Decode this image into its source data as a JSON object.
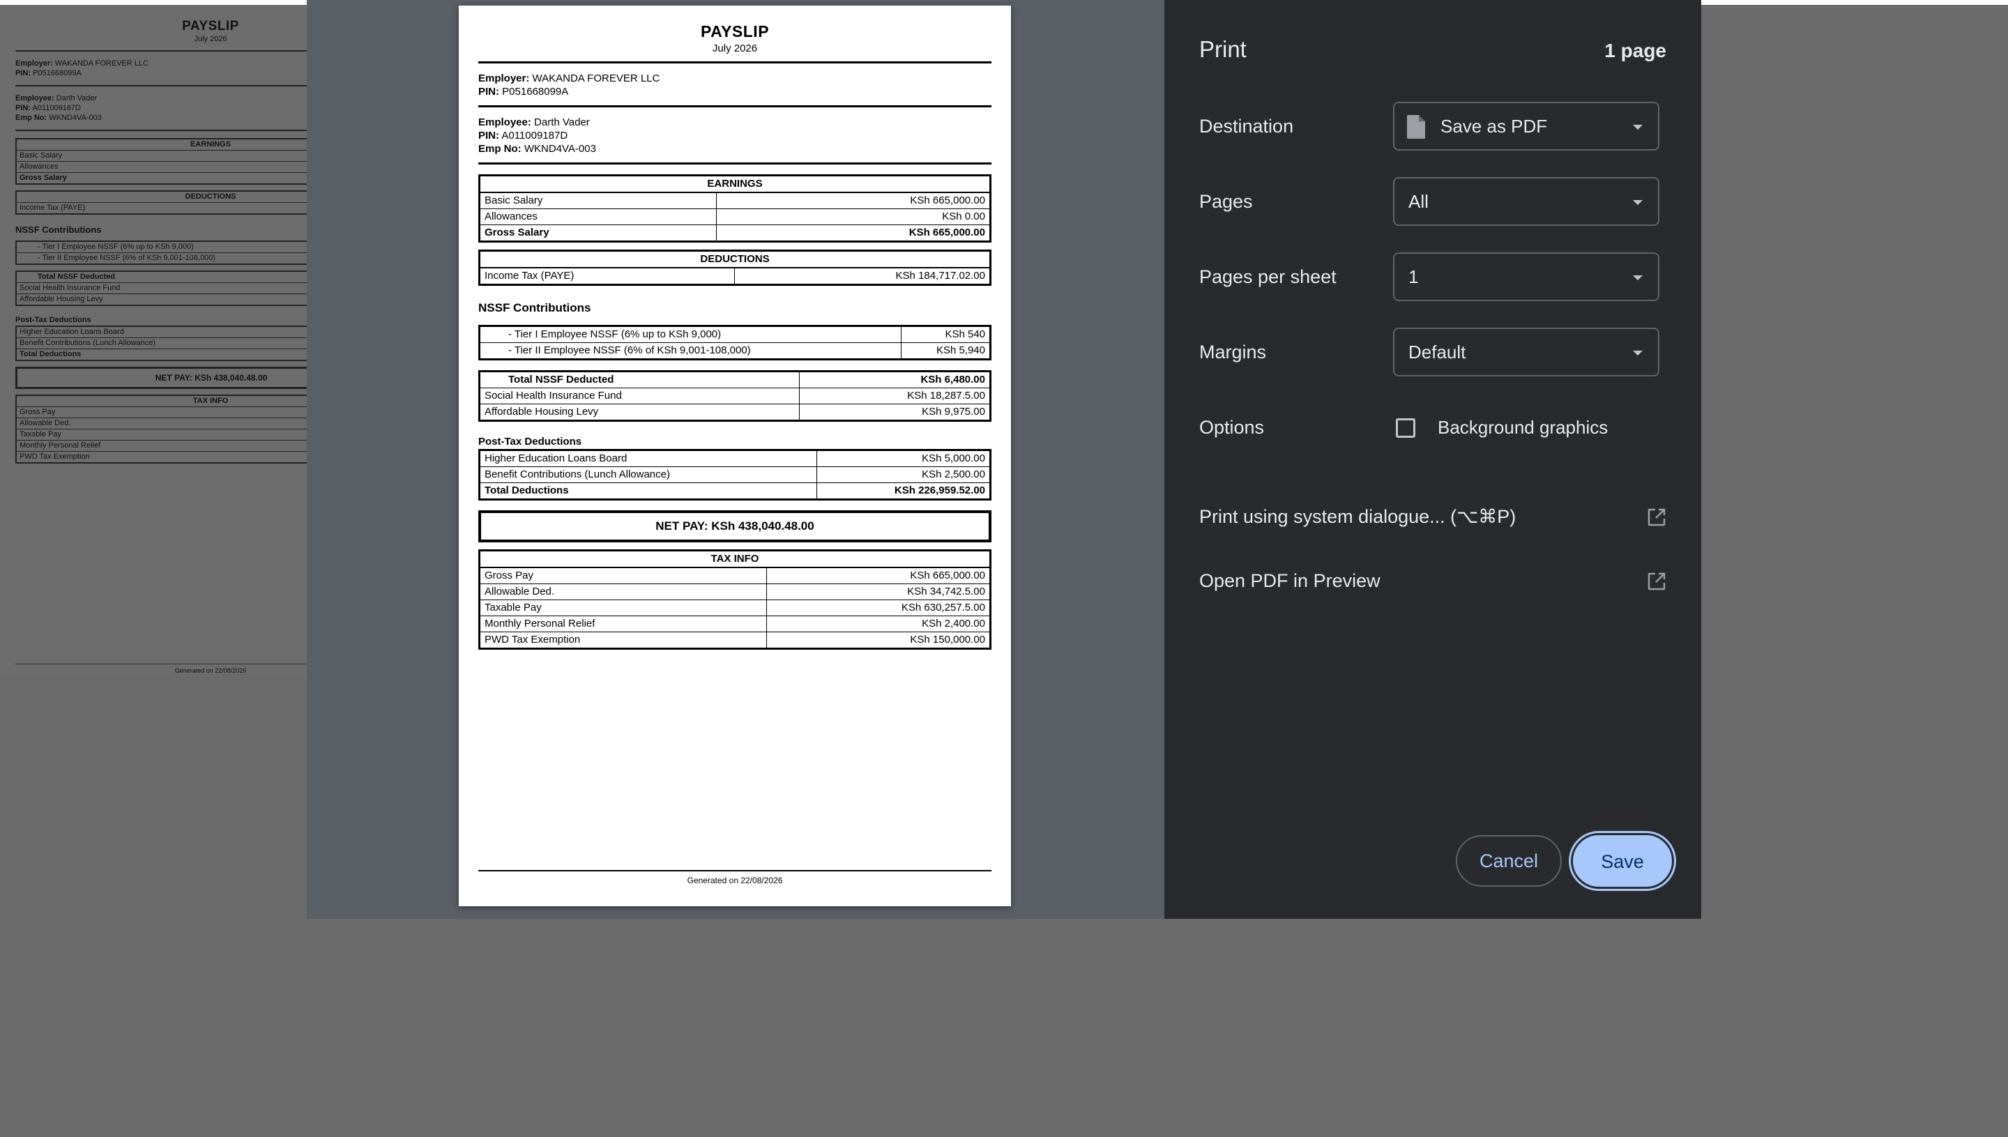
{
  "payslip": {
    "title": "PAYSLIP",
    "period": "July 2026",
    "employer_label": "Employer:",
    "employer_name": "WAKANDA FOREVER LLC",
    "employer_pin_label": "PIN:",
    "employer_pin": "P051668099A",
    "employee_label": "Employee:",
    "employee_name": "Darth Vader",
    "employee_pin_label": "PIN:",
    "employee_pin": "A011009187D",
    "emp_no_label": "Emp No:",
    "emp_no": "WKND4VA-003",
    "earnings": {
      "header": "EARNINGS",
      "rows": [
        {
          "label": "Basic Salary",
          "value": "KSh 665,000.00"
        },
        {
          "label": "Allowances",
          "value": "KSh 0.00"
        },
        {
          "label": "Gross Salary",
          "value": "KSh 665,000.00"
        }
      ]
    },
    "deductions": {
      "header": "DEDUCTIONS",
      "rows": [
        {
          "label": "Income Tax (PAYE)",
          "value": "KSh 184,717.02.00"
        }
      ]
    },
    "nssf": {
      "heading": "NSSF Contributions",
      "rows": [
        {
          "label": "- Tier I Employee NSSF (6% up to KSh 9,000)",
          "value": "KSh 540"
        },
        {
          "label": "- Tier II Employee NSSF (6% of KSh 9,001-108,000)",
          "value": "KSh 5,940"
        }
      ]
    },
    "other_deductions": {
      "rows": [
        {
          "label": "Total NSSF Deducted",
          "value": "KSh 6,480.00"
        },
        {
          "label": "Social Health Insurance Fund",
          "value": "KSh 18,287.5.00"
        },
        {
          "label": "Affordable Housing Levy",
          "value": "KSh 9,975.00"
        }
      ]
    },
    "post_tax": {
      "heading": "Post-Tax Deductions",
      "rows": [
        {
          "label": "Higher Education Loans Board",
          "value": "KSh 5,000.00"
        },
        {
          "label": "Benefit Contributions (Lunch Allowance)",
          "value": "KSh 2,500.00"
        },
        {
          "label": "Total Deductions",
          "value": "KSh 226,959.52.00"
        }
      ]
    },
    "net_pay": "NET PAY: KSh 438,040.48.00",
    "tax_info": {
      "header": "TAX INFO",
      "rows": [
        {
          "label": "Gross Pay",
          "value": "KSh 665,000.00"
        },
        {
          "label": "Allowable Ded.",
          "value": "KSh 34,742.5.00"
        },
        {
          "label": "Taxable Pay",
          "value": "KSh 630,257.5.00"
        },
        {
          "label": "Monthly Personal Relief",
          "value": "KSh 2,400.00"
        },
        {
          "label": "PWD Tax Exemption",
          "value": "KSh 150,000.00"
        }
      ]
    },
    "footer": "Generated on 22/08/2026"
  },
  "print_dialog": {
    "title": "Print",
    "page_count": "1 page",
    "destination_label": "Destination",
    "destination_value": "Save as PDF",
    "pages_label": "Pages",
    "pages_value": "All",
    "pages_per_sheet_label": "Pages per sheet",
    "pages_per_sheet_value": "1",
    "margins_label": "Margins",
    "margins_value": "Default",
    "options_label": "Options",
    "background_graphics_label": "Background graphics",
    "background_graphics_checked": false,
    "system_dialog_link": "Print using system dialogue... (⌥⌘P)",
    "open_pdf_link": "Open PDF in Preview",
    "cancel_label": "Cancel",
    "save_label": "Save"
  },
  "colors": {
    "panel_bg": "#292a2d",
    "preview_bg": "#5a5f66",
    "accent": "#a8c7fa",
    "backdrop": "#6b6b6b"
  },
  "icons": {
    "destination": "file-icon",
    "dropdown": "chevron-down-icon",
    "external": "open-external-icon"
  }
}
